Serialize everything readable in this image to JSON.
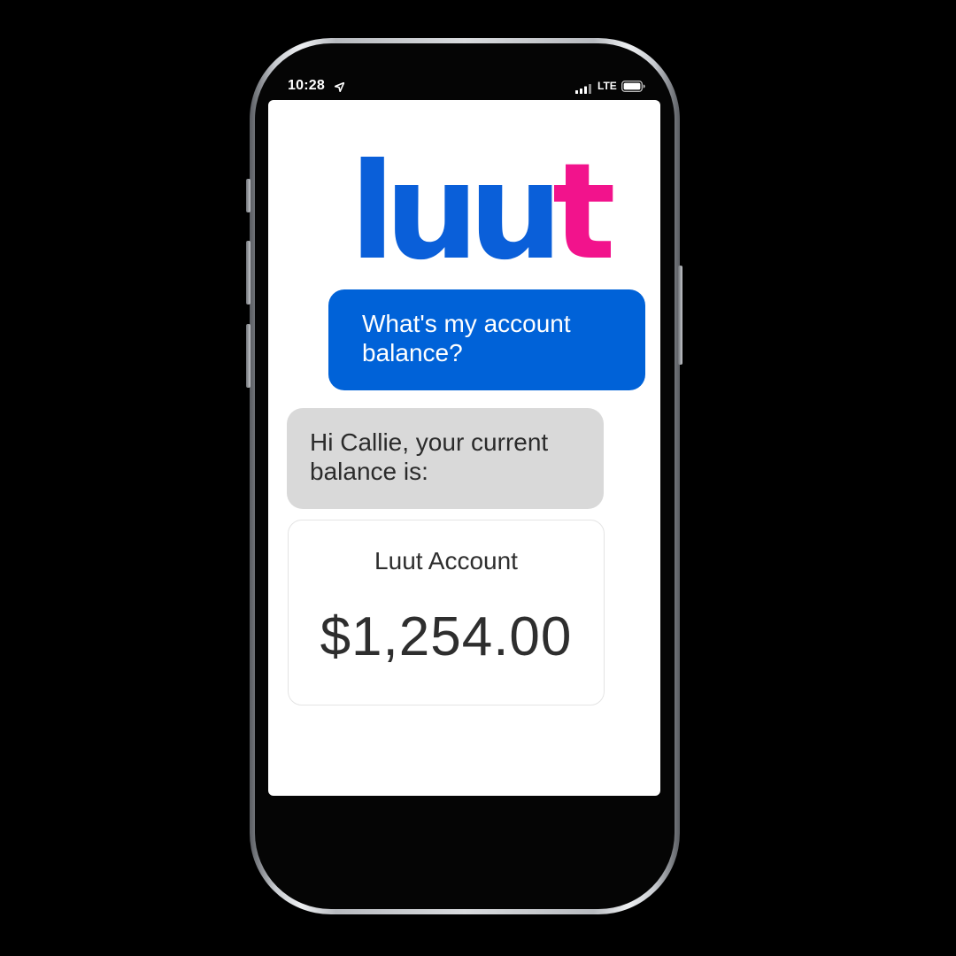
{
  "status_bar": {
    "time": "10:28",
    "network": "LTE"
  },
  "logo": {
    "part1": "luu",
    "part2": "t",
    "colors": {
      "primary": "#0a5fd9",
      "accent": "#f2138c"
    }
  },
  "chat": {
    "user_message": "What's my account balance?",
    "bot_message": "Hi Callie, your current balance is:"
  },
  "balance_card": {
    "title": "Luut Account",
    "amount": "$1,254.00"
  },
  "colors": {
    "user_bubble": "#0062d8",
    "bot_bubble": "#d9d9d9"
  },
  "icons": [
    "location-arrow-icon",
    "signal-bars-icon",
    "battery-icon"
  ]
}
